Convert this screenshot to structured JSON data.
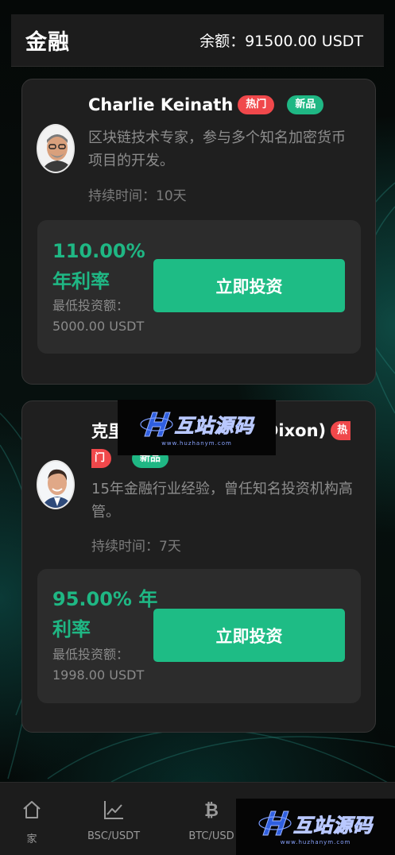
{
  "header": {
    "title": "金融",
    "balance": "余额：91500.00 USDT"
  },
  "products": [
    {
      "name": "Charlie Keinath",
      "badge_hot": "热门",
      "badge_new": "新品",
      "description": "区块链技术专家，参与多个知名加密货币项目的开发。",
      "duration": "持续时间：10天",
      "rate": "110.00% 年利率",
      "min_investment": "最低投资额：5000.00 USDT",
      "button": "立即投资"
    },
    {
      "name": "克里",
      "name_suffix": "Dixon)",
      "badge_hot_part1": "热",
      "badge_hot_part2": "门",
      "badge_new": "新品",
      "description": "15年金融行业经验，曾任知名投资机构高管。",
      "duration": "持续时间：7天",
      "rate": "95.00% 年利率",
      "min_investment": "最低投资额：1998.00 USDT",
      "button": "立即投资"
    }
  ],
  "watermark": {
    "text": "互站源码",
    "url": "www.huzhanym.com"
  },
  "tabbar": [
    {
      "label": "家",
      "icon": "home-icon"
    },
    {
      "label": "BSC/USDT",
      "icon": "chart-line-icon"
    },
    {
      "label": "BTC/USD",
      "icon": "bitcoin-icon"
    }
  ],
  "colors": {
    "accent": "#1ebc85",
    "hot": "#f0484b",
    "card": "#1f1f1f"
  }
}
